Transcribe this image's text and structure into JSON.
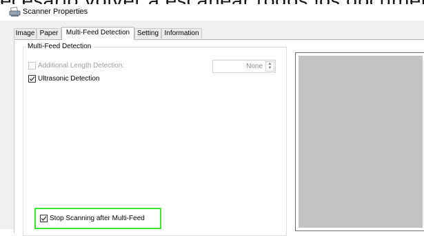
{
  "background_text": "ecesario volver a escanear todos los documen",
  "window": {
    "title": "Scanner Properties",
    "icon": "scanner-icon"
  },
  "tabs": [
    {
      "label": "Image",
      "active": false
    },
    {
      "label": "Paper",
      "active": false
    },
    {
      "label": "Multi-Feed Detection",
      "active": true
    },
    {
      "label": "Setting",
      "active": false
    },
    {
      "label": "Information",
      "active": false
    }
  ],
  "multifeed": {
    "group_label": "Multi-Feed Detection",
    "additional_length": {
      "label": "Additional Length Detection:",
      "checked": false,
      "enabled": false
    },
    "length_value": "None",
    "ultrasonic": {
      "label": "Ultrasonic Detection",
      "checked": true
    },
    "stop_scanning": {
      "label": "Stop Scanning after Multi-Feed",
      "checked": true
    }
  },
  "colors": {
    "highlight": "#35e82b",
    "preview_fill": "#c3c3c3"
  }
}
